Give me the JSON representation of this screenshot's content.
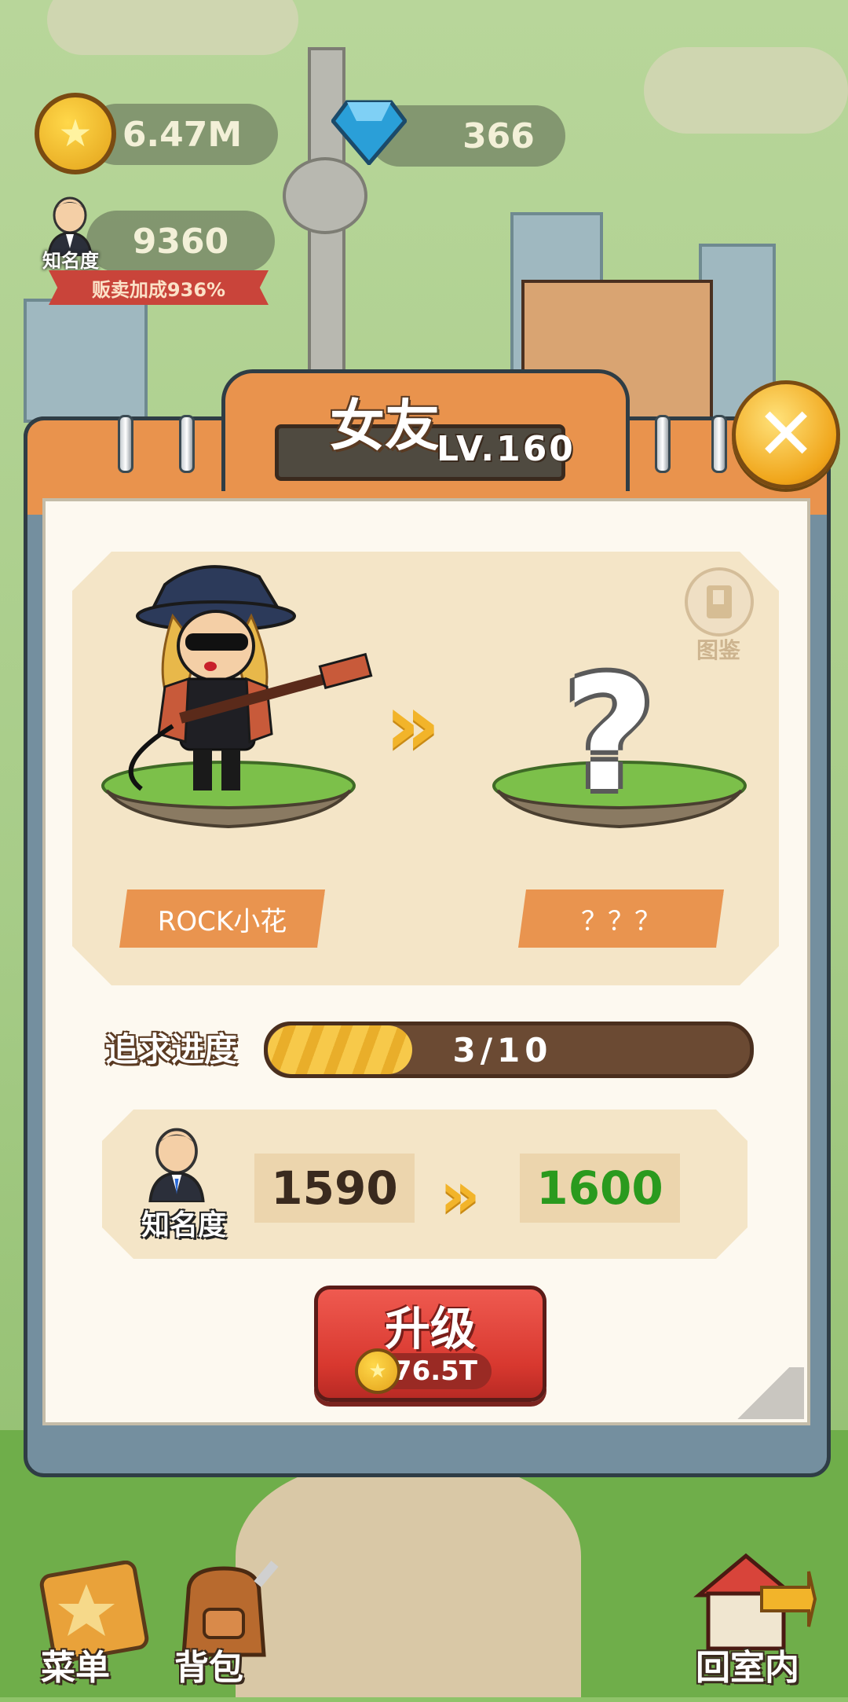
{
  "hud": {
    "coins": "6.47M",
    "gems": "366",
    "fame_value": "9360",
    "fame_label": "知名度",
    "sales_bonus": "贩卖加成936%"
  },
  "dialog": {
    "title": "女友",
    "level": "LV.160",
    "close_symbol": "✕",
    "current_name": "ROCK小花",
    "next_name": "？？？",
    "unknown_symbol": "?",
    "album_label": "图鉴",
    "progress_label": "追求进度",
    "progress_text": "3/10",
    "progress_fraction": 0.3,
    "fame_label": "知名度",
    "fame_current": "1590",
    "fame_next": "1600",
    "upgrade_label": "升级",
    "upgrade_cost": "76.5T",
    "arrow_glyph": "»"
  },
  "bottom_nav": {
    "menu_label": "菜单",
    "bag_label": "背包",
    "home_label": "回室内"
  },
  "colors": {
    "fame_next": "#2a9a1e",
    "fame_current": "#3a2a1e",
    "accent_orange": "#e9934d",
    "upgrade_red": "#d8382f"
  }
}
